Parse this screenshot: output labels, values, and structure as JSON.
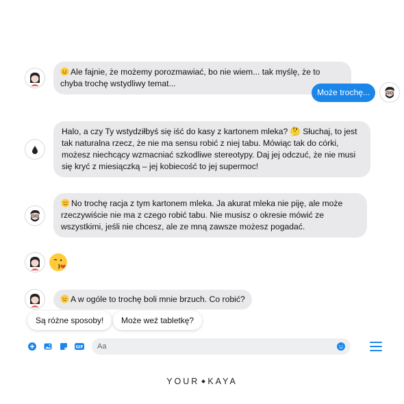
{
  "messages": [
    {
      "emoji": "smile-emoji",
      "text": "Ale fajnie, że możemy porozmawiać, bo nie wiem... tak myślę, że to chyba trochę wstydliwy temat..."
    },
    {
      "text": "Może trochę..."
    },
    {
      "text": "Halo, a czy Ty wstydziłbyś się iść do kasy z kartonem mleka? 🤔 Słuchaj, to jest tak naturalna rzecz, że nie ma sensu robić z niej tabu. Mówiąc tak do córki, możesz niechcący wzmacniać szkodliwe stereotypy. Daj jej odczuć, że nie musi się kryć z miesiączką – jej kobiecość to jej supermoc!"
    },
    {
      "emoji": "smile-emoji",
      "text": "No trochę racja z tym kartonem mleka. Ja akurat mleka nie piję, ale może rzeczywiście nie ma z czego robić tabu. Nie musisz o okresie mówić ze wszystkimi, jeśli nie chcesz, ale ze mną zawsze możesz pogadać."
    },
    {
      "emoji": "kiss-emoji"
    },
    {
      "emoji": "sad-emoji",
      "text": "A w ogóle to trochę boli mnie brzuch. Co robić?"
    }
  ],
  "quick_replies": [
    "Są różne sposoby!",
    "Może weź tabletkę?"
  ],
  "composer": {
    "placeholder": "Aa"
  },
  "brand": {
    "left": "YOUR",
    "right": "KAYA"
  },
  "colors": {
    "accent": "#1a86ea",
    "bubble": "#e9e9eb"
  }
}
